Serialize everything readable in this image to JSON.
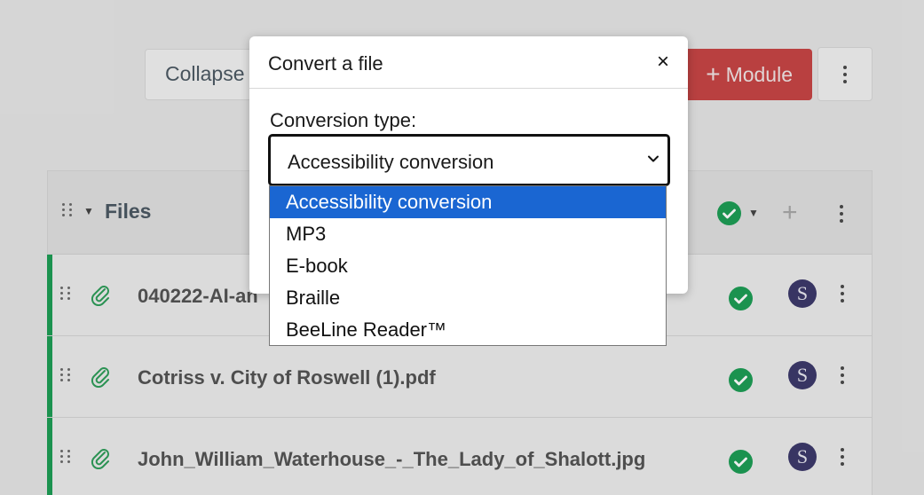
{
  "toolbar": {
    "collapse_label": "Collapse",
    "module_label": "Module"
  },
  "module": {
    "title": "Files",
    "items": [
      {
        "name": "040222-AI-an",
        "avatar": "S"
      },
      {
        "name": "Cotriss v. City of Roswell (1).pdf",
        "avatar": "S"
      },
      {
        "name": "John_William_Waterhouse_-_The_Lady_of_Shalott.jpg",
        "avatar": "S"
      }
    ]
  },
  "modal": {
    "title": "Convert a file",
    "close_symbol": "×",
    "field_label": "Conversion type:",
    "selected_value": "Accessibility conversion",
    "options": [
      "Accessibility conversion",
      "MP3",
      "E-book",
      "Braille",
      "BeeLine Reader™"
    ]
  },
  "colors": {
    "published_green": "#1e9e56",
    "module_button_red": "#c84545",
    "selected_option_blue": "#1a66d2",
    "avatar_purple": "#3d3a6b"
  }
}
